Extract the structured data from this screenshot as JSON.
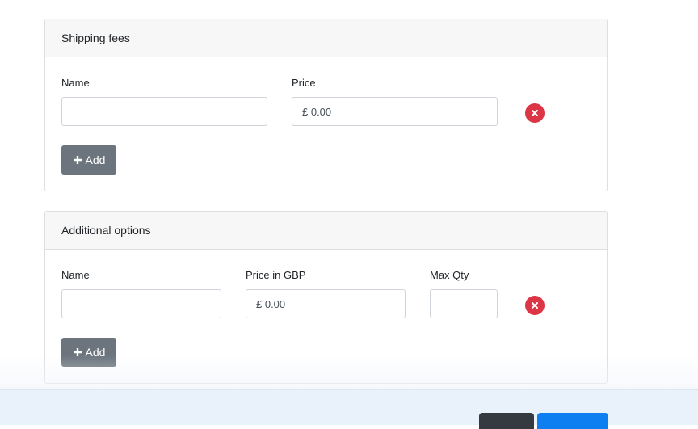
{
  "shipping": {
    "title": "Shipping fees",
    "name_label": "Name",
    "price_label": "Price",
    "name_value": "",
    "price_value": "£ 0.00",
    "add_label": "Add"
  },
  "options": {
    "title": "Additional options",
    "name_label": "Name",
    "price_label": "Price in GBP",
    "qty_label": "Max Qty",
    "name_value": "",
    "price_value": "£ 0.00",
    "qty_value": "",
    "add_label": "Add"
  },
  "colors": {
    "remove": "#dc3545",
    "add_button": "#6c757d",
    "footer_dark": "#343a40",
    "footer_primary": "#0d7ff0"
  }
}
